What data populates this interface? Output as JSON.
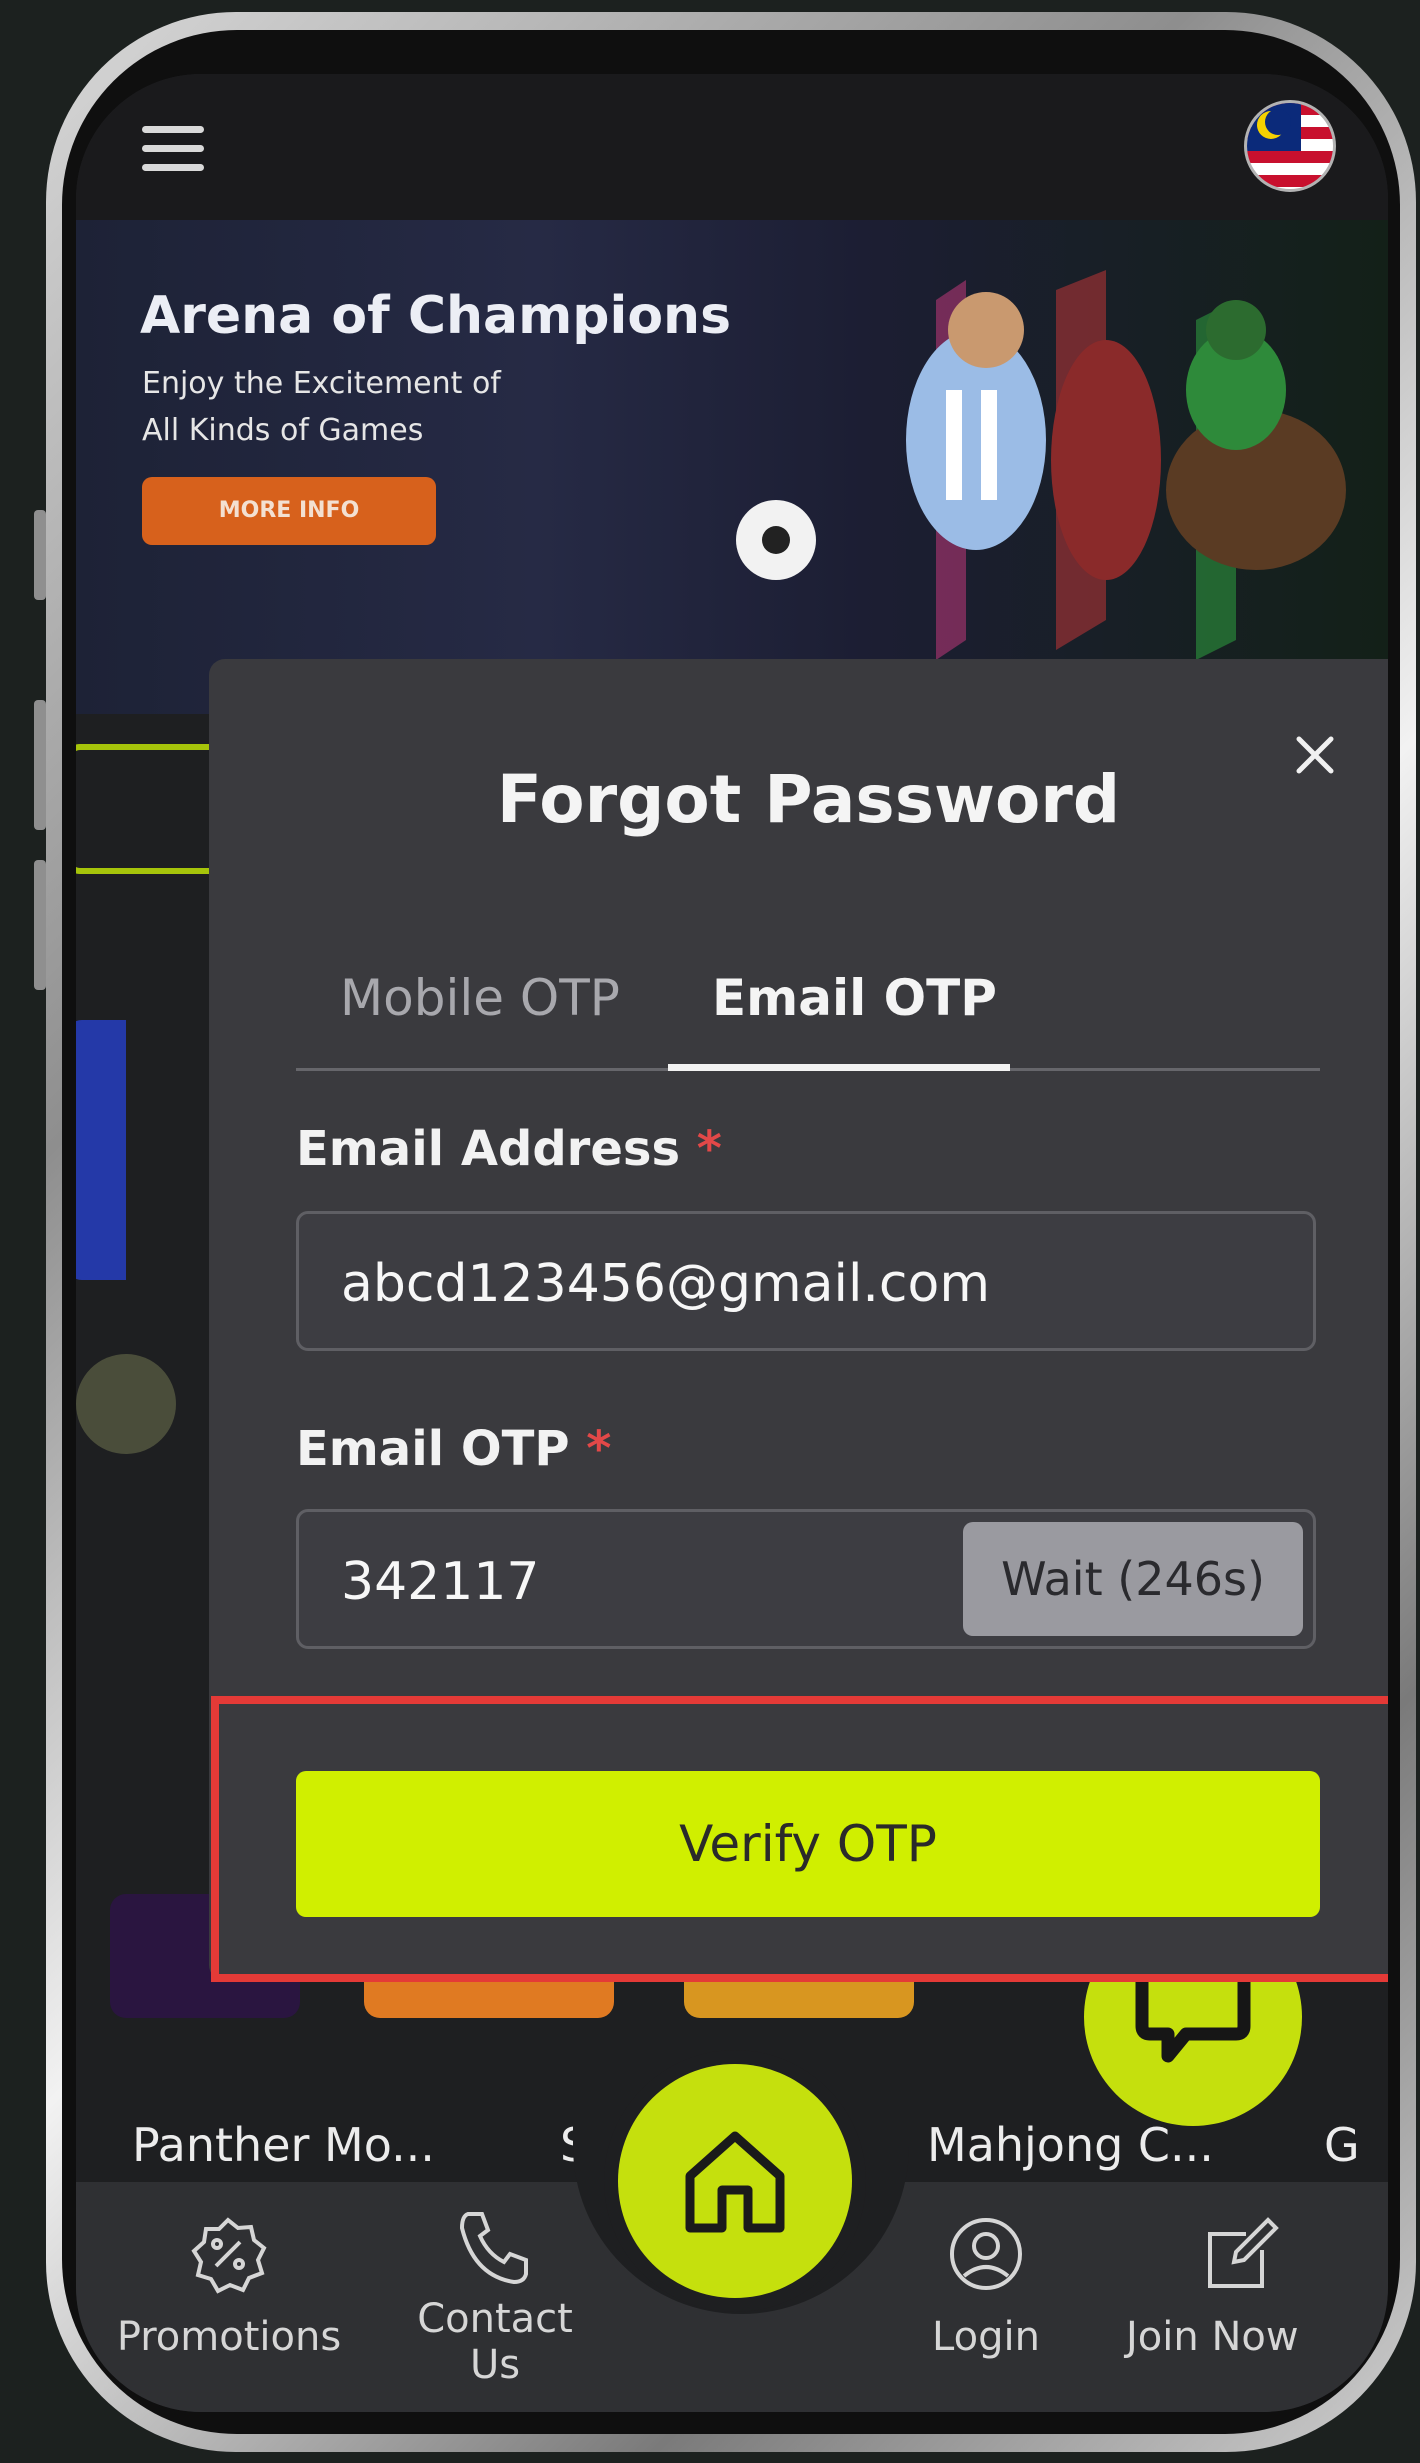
{
  "header": {
    "menu_icon": "hamburger-icon",
    "flag_icon": "malaysia-flag-icon"
  },
  "banner": {
    "title": "Arena of Champions",
    "subtitle_line1": "Enjoy the Excitement of",
    "subtitle_line2": "All Kinds of Games",
    "button_label": "MORE INFO"
  },
  "games": [
    {
      "label": "Panther Mo..."
    },
    {
      "label": "Su"
    },
    {
      "label": "Mahjong C..."
    },
    {
      "label": "G"
    }
  ],
  "modal": {
    "title": "Forgot Password",
    "close_icon": "close-icon",
    "tabs": [
      {
        "label": "Mobile OTP",
        "active": false
      },
      {
        "label": "Email OTP",
        "active": true
      }
    ],
    "email_label": "Email Address",
    "email_value": "abcd123456@gmail.com",
    "otp_label": "Email OTP",
    "otp_value": "342117",
    "required_mark": "*",
    "wait_label": "Wait (246s)",
    "verify_label": "Verify OTP"
  },
  "bottom_nav": [
    {
      "label": "Promotions",
      "icon": "percent-badge-icon"
    },
    {
      "label_line1": "Contact",
      "label_line2": "Us",
      "icon": "phone-icon"
    },
    {
      "label": "Home",
      "icon": "home-icon"
    },
    {
      "label": "Login",
      "icon": "user-circle-icon"
    },
    {
      "label": "Join Now",
      "icon": "edit-icon"
    }
  ],
  "chat": {
    "icon": "chat-icon"
  },
  "colors": {
    "accent": "#d0ef00",
    "highlight_border": "#e43a37",
    "banner_button": "#d7611c"
  }
}
